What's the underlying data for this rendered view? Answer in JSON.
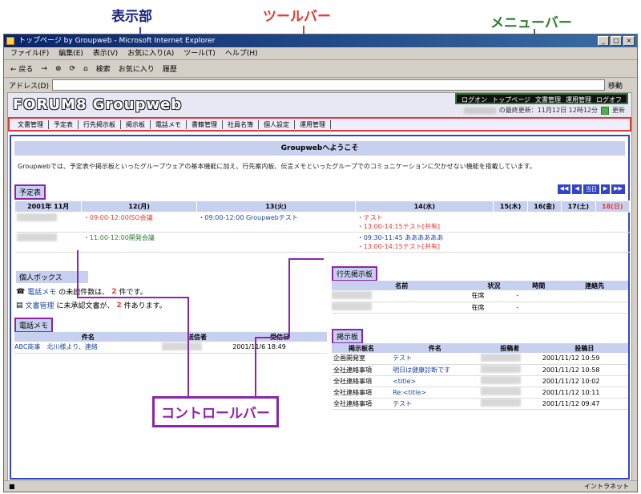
{
  "callouts": {
    "display": "表示部",
    "toolbar": "ツールバー",
    "menubar": "メニューバー",
    "controlbar": "コントロールバー"
  },
  "window": {
    "title": "トップページ by Groupweb - Microsoft Internet Explorer",
    "buttons": [
      "_",
      "□",
      "×"
    ]
  },
  "ie_menu": [
    "ファイル(F)",
    "編集(E)",
    "表示(V)",
    "お気に入り(A)",
    "ツール(T)",
    "ヘルプ(H)"
  ],
  "ie_toolbar": [
    "← 戻る",
    "→",
    "⊗",
    "⟳",
    "⌂",
    "検索",
    "お気に入り",
    "履歴"
  ],
  "address": {
    "label": "アドレス(D)",
    "go": "移動"
  },
  "header": {
    "logo": "FORUM8 Groupweb",
    "top_nav": [
      "ログオン",
      "トップページ",
      "文書管理",
      "運用管理",
      "ログオフ"
    ],
    "last_update": "の最終更新：11月12日 12時12分",
    "refresh": "更新"
  },
  "toolbar_items": [
    "文書管理",
    "予定表",
    "行先掲示板",
    "掲示板",
    "電話メモ",
    "書籍管理",
    "社員名簿",
    "個人設定",
    "運用管理"
  ],
  "welcome": "Groupwebへようこそ",
  "intro": "Groupwebでは、予定表や掲示板といったグループウェアの基本機能に加え、行先案内板、伝言メモといったグループでのコミュニケーションに欠かせない機能を搭載しています。",
  "schedule": {
    "label": "予定表",
    "nav": [
      "◀◀",
      "◀",
      "当日",
      "▶",
      "▶▶"
    ],
    "month": "2001年 11月",
    "days": [
      "12(月)",
      "13(火)",
      "14(水)",
      "15(木)",
      "16(金)",
      "17(土)",
      "18(日)"
    ],
    "row1": {
      "mon": "・09:00-12:00ISO会議",
      "tue": "・09:00-12:00 Groupwebテスト",
      "wed1": "・テスト",
      "wed2": "・13:00-14:15テスト[共有]"
    },
    "row2": {
      "mon": "・11:00-12:00開発会議",
      "wed1": "・09:30-11:45 ああああああ",
      "wed2": "・13:00-14:15テスト[共有]"
    }
  },
  "personal": {
    "label": "個人ボックス",
    "memo_link": "電話メモ",
    "memo_text1": "の未読件数は、",
    "memo_count": "2",
    "memo_text2": "件です。",
    "doc_link": "文書管理",
    "doc_text1": "に未承認文書が、",
    "doc_count": "2",
    "doc_text2": "件あります。"
  },
  "phone_memo": {
    "label": "電話メモ",
    "headers": [
      "件名",
      "送信者",
      "受信日"
    ],
    "rows": [
      {
        "subject": "ABC商事　北川様より、連絡",
        "date": "2001/11/6 18:49"
      }
    ]
  },
  "destination": {
    "label": "行先掲示板",
    "headers": [
      "名前",
      "状況",
      "時間",
      "連絡先"
    ],
    "rows": [
      {
        "status": "在席",
        "time": "-"
      },
      {
        "status": "在席",
        "time": "-"
      }
    ]
  },
  "bbs": {
    "label": "掲示板",
    "headers": [
      "掲示板名",
      "件名",
      "投稿者",
      "投稿日"
    ],
    "rows": [
      {
        "board": "企画開発室",
        "subject": "テスト",
        "date": "2001/11/12 10:59"
      },
      {
        "board": "全社連絡事項",
        "subject": "明日は健康診断です",
        "date": "2001/11/12 10:58"
      },
      {
        "board": "全社連絡事項",
        "subject": "<title>",
        "date": "2001/11/12 10:02"
      },
      {
        "board": "全社連絡事項",
        "subject": "Re:<title>",
        "date": "2001/11/12 10:11"
      },
      {
        "board": "全社連絡事項",
        "subject": "テスト",
        "date": "2001/11/12 09:47"
      }
    ]
  },
  "status_bar": {
    "zone": "イントラネット"
  }
}
